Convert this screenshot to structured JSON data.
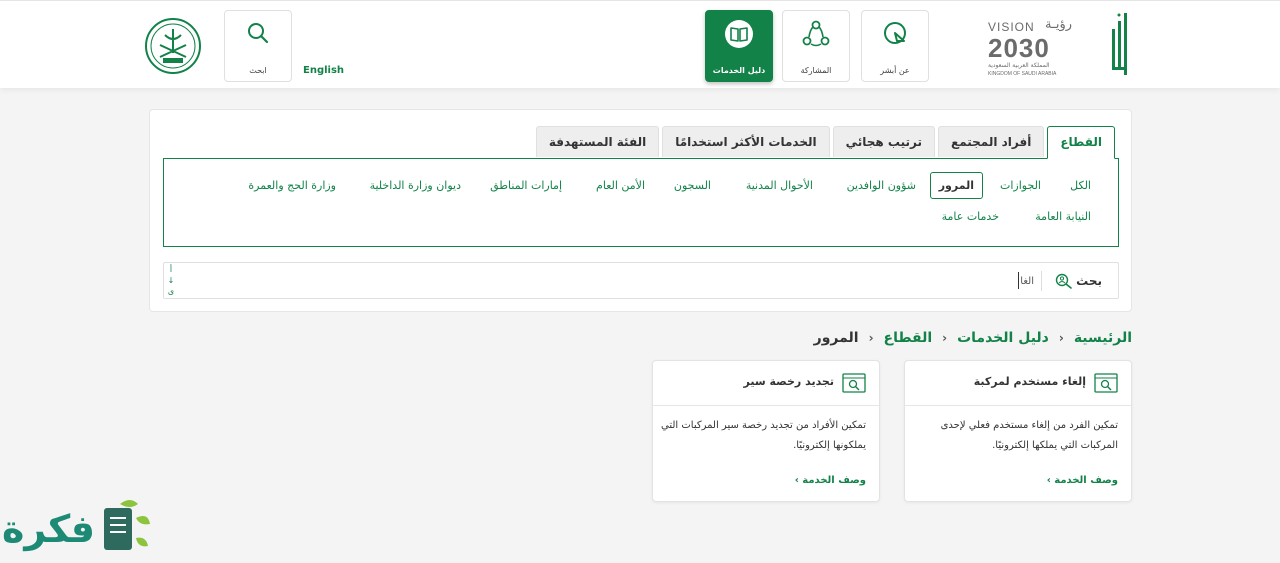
{
  "header": {
    "nav": [
      {
        "id": "about",
        "label": "عن أبشر",
        "icon": "absher-pin-icon",
        "active": false
      },
      {
        "id": "participation",
        "label": "المشاركة",
        "icon": "network-icon",
        "active": false
      },
      {
        "id": "services-guide",
        "label": "دليل الخدمات",
        "icon": "book-icon",
        "active": true
      },
      {
        "id": "search",
        "label": "ابحث",
        "icon": "search-icon",
        "active": false
      }
    ],
    "language_link": "English",
    "logos": {
      "vision_title": "VISION",
      "vision_arabic": "رؤيـة",
      "vision_year": "2030",
      "vision_country_ar": "المملكة العربية السعودية",
      "vision_country_en": "KINGDOM OF SAUDI ARABIA",
      "absher": "أبشر"
    }
  },
  "tabs": [
    {
      "label": "القطاع",
      "active": true
    },
    {
      "label": "أفراد المجتمع",
      "active": false
    },
    {
      "label": "ترتيب هجائي",
      "active": false
    },
    {
      "label": "الخدمات الأكثر استخدامًا",
      "active": false
    },
    {
      "label": "الفئة المستهدفة",
      "active": false
    }
  ],
  "sectors": [
    {
      "label": "الكل",
      "active": false
    },
    {
      "label": "الجوازات",
      "active": false
    },
    {
      "label": "المرور",
      "active": true
    },
    {
      "label": "شؤون الوافدين",
      "active": false
    },
    {
      "label": "الأحوال المدنية",
      "active": false
    },
    {
      "label": "السجون",
      "active": false
    },
    {
      "label": "الأمن العام",
      "active": false
    },
    {
      "label": "إمارات المناطق",
      "active": false
    },
    {
      "label": "ديوان وزارة الداخلية",
      "active": false
    },
    {
      "label": "وزارة الحج والعمرة",
      "active": false
    },
    {
      "label": "النيابة العامة",
      "active": false
    },
    {
      "label": "خدمات عامة",
      "active": false
    }
  ],
  "search": {
    "label": "بحث",
    "value": "الغا",
    "side_marks": [
      "أ",
      "↓",
      "ى"
    ]
  },
  "breadcrumb": [
    {
      "label": "الرئيسية",
      "current": false
    },
    {
      "label": "دليل الخدمات",
      "current": false
    },
    {
      "label": "القطاع",
      "current": false
    },
    {
      "label": "المرور",
      "current": true
    }
  ],
  "breadcrumb_separator": "›",
  "cards": [
    {
      "title": "إلغاء مستخدم لمركبة",
      "description": "تمكين الفرد من إلغاء مستخدم فعلي لإحدى المركبات التي يملكها إلكترونيًا.",
      "link": "وصف الخدمة ›"
    },
    {
      "title": "تجديد رخصة سير",
      "description": "تمكين الأفراد من تجديد رخصة سير المركبات التي يملكونها إلكترونيًا.",
      "link": "وصف الخدمة ›"
    }
  ],
  "watermark": "فكرة",
  "colors": {
    "brand": "#128249",
    "watermark": "#1c8a74"
  }
}
